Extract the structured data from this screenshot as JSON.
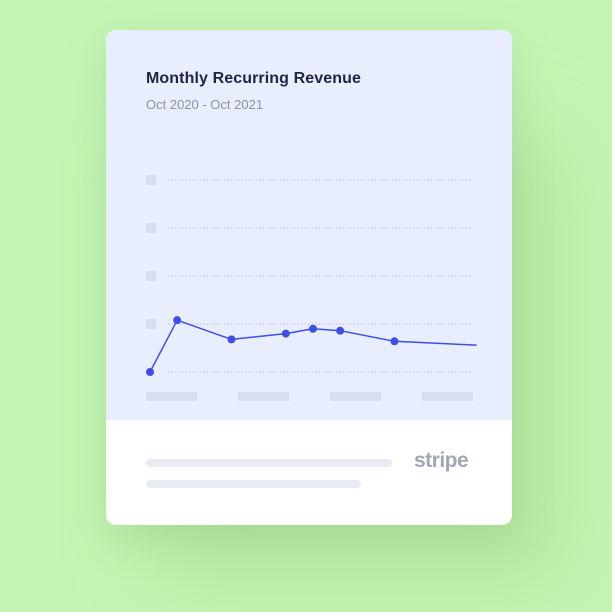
{
  "card": {
    "title": "Monthly Recurring Revenue",
    "subtitle": "Oct 2020 - Oct 2021",
    "brand": "stripe"
  },
  "colors": {
    "background": "#c5f5b4",
    "panel": "#e8eefe",
    "line": "#3d4fe6",
    "placeholder": "#d7deef"
  },
  "chart_data": {
    "type": "line",
    "title": "Monthly Recurring Revenue",
    "subtitle": "Oct 2020 - Oct 2021",
    "x": [
      0,
      1,
      3,
      5,
      6,
      7,
      9,
      12
    ],
    "values": [
      0,
      0.54,
      0.34,
      0.4,
      0.45,
      0.43,
      0.32,
      0.28
    ],
    "marker_indices": [
      0,
      1,
      2,
      3,
      4,
      5,
      6
    ],
    "xlim": [
      0,
      12
    ],
    "ylim": [
      0,
      2
    ],
    "grid": true,
    "ytick_count": 5,
    "xtick_count": 4
  }
}
